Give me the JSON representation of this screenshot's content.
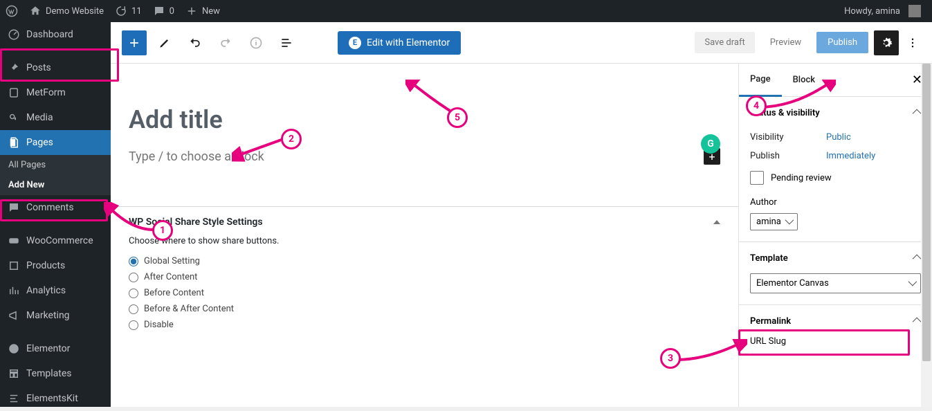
{
  "adminbar": {
    "site_name": "Demo Website",
    "updates_count": "11",
    "comments_count": "0",
    "new_label": "New",
    "howdy": "Howdy, amina"
  },
  "menu": {
    "dashboard": "Dashboard",
    "posts": "Posts",
    "metform": "MetForm",
    "media": "Media",
    "pages": "Pages",
    "pages_sub": {
      "all": "All Pages",
      "add_new": "Add New"
    },
    "comments": "Comments",
    "woocommerce": "WooCommerce",
    "products": "Products",
    "analytics": "Analytics",
    "marketing": "Marketing",
    "elementor": "Elementor",
    "templates": "Templates",
    "elementskit": "ElementsKit"
  },
  "toolbar": {
    "elementor_button": "Edit with Elementor",
    "save_draft": "Save draft",
    "preview": "Preview",
    "publish": "Publish"
  },
  "editor": {
    "title_placeholder": "Add title",
    "block_placeholder": "Type / to choose a block"
  },
  "metabox": {
    "heading": "WP Social Share Style Settings",
    "desc": "Choose where to show share buttons.",
    "options": [
      "Global Setting",
      "After Content",
      "Before Content",
      "Before & After Content",
      "Disable"
    ],
    "selected_index": 0
  },
  "settings": {
    "tabs": {
      "page": "Page",
      "block": "Block"
    },
    "status": {
      "heading": "Status & visibility",
      "visibility_label": "Visibility",
      "visibility_value": "Public",
      "publish_label": "Publish",
      "publish_value": "Immediately",
      "pending": "Pending review",
      "author_label": "Author",
      "author_value": "amina"
    },
    "template": {
      "heading": "Template",
      "value": "Elementor Canvas"
    },
    "permalink": {
      "heading": "Permalink",
      "slug_label": "URL Slug"
    }
  },
  "annotations": {
    "n1": "1",
    "n2": "2",
    "n3": "3",
    "n4": "4",
    "n5": "5"
  }
}
